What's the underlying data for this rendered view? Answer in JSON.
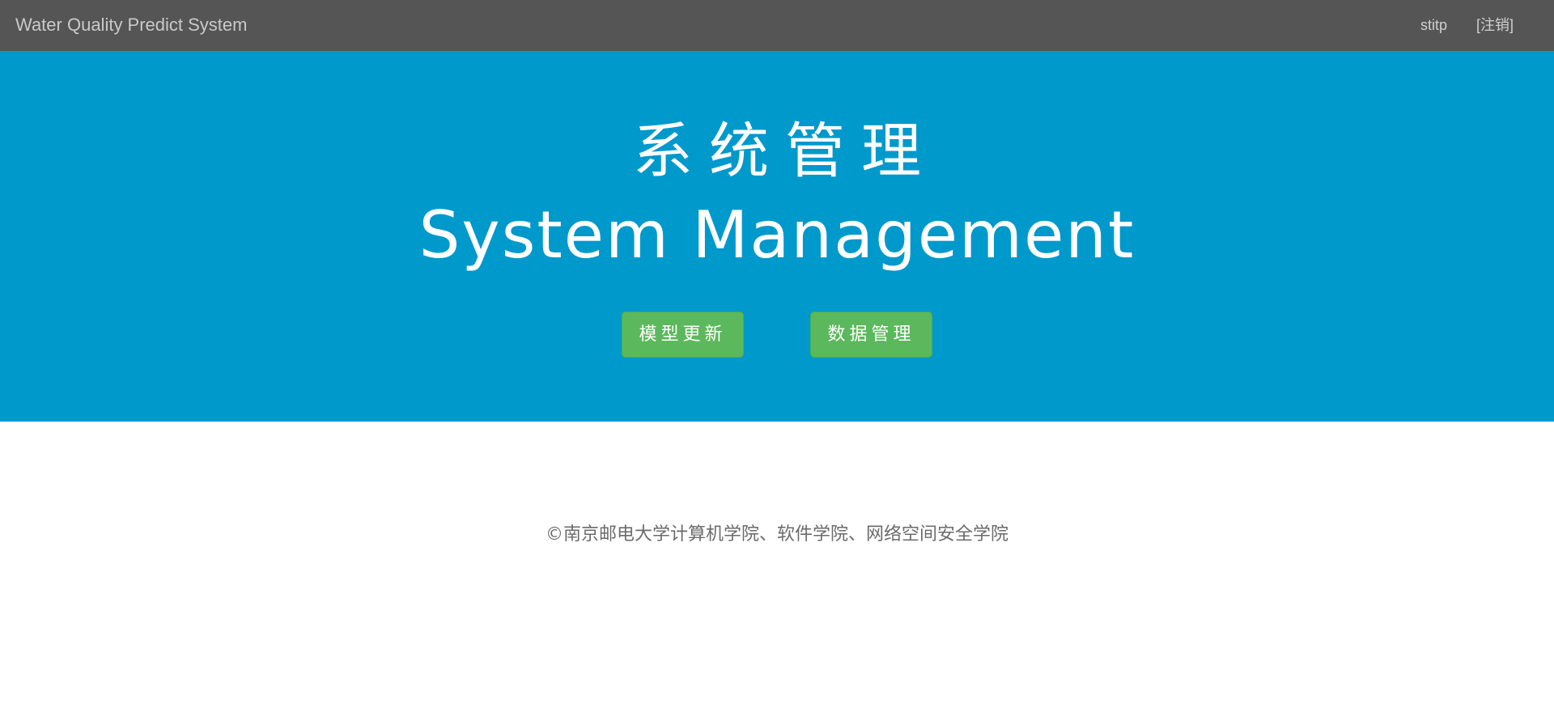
{
  "navbar": {
    "brand": "Water Quality Predict System",
    "user": "stitp",
    "logout": "[注销]"
  },
  "hero": {
    "title_cn": "系统管理",
    "title_en": "System Management",
    "buttons": {
      "model_update": "模型更新",
      "data_management": "数据管理"
    }
  },
  "footer": {
    "copyright": "©南京邮电大学计算机学院、软件学院、网络空间安全学院"
  },
  "colors": {
    "navbar_bg": "#555555",
    "hero_bg": "#0099cc",
    "button_bg": "#5cb85c",
    "footer_text": "#6b6b6b"
  }
}
